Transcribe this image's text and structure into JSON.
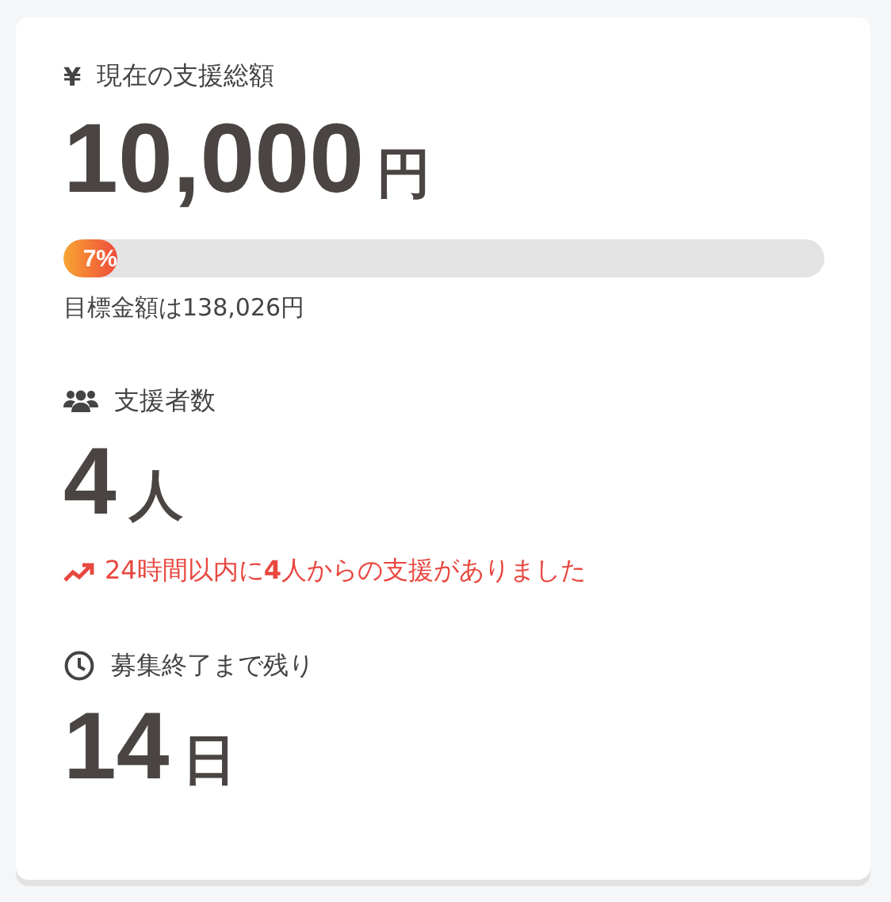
{
  "sections": [
    {
      "kind": "amount",
      "icon_char": "¥",
      "title": "現在の支援総額",
      "value": "10,000",
      "unit": "円",
      "progress": {
        "level": 0.07,
        "label": "7%"
      },
      "note": "目標金額は138,026円"
    },
    {
      "kind": "supporters",
      "title": "支援者数",
      "value": "4",
      "unit": "人",
      "trend": "24時間以内に**4**人からの支援がありました"
    },
    {
      "kind": "remaining",
      "title": "募集終了まで残り",
      "value": "14",
      "unit": "日"
    }
  ]
}
